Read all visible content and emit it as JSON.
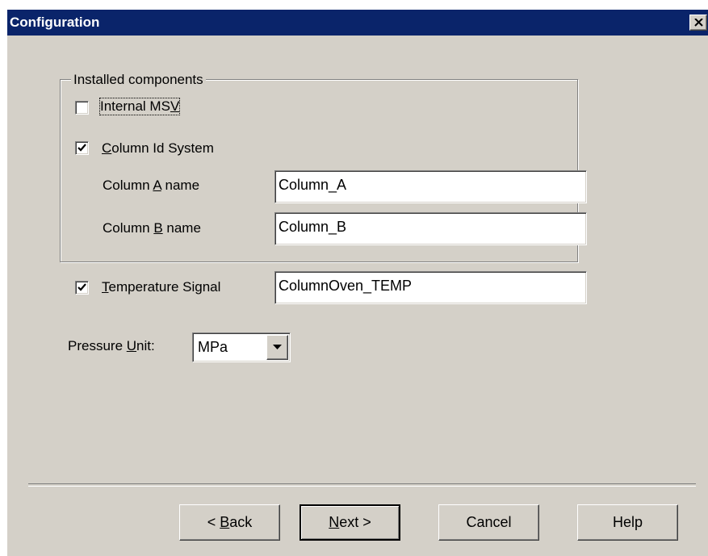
{
  "window": {
    "title": "Configuration"
  },
  "group": {
    "legend": "Installed components",
    "internal_msv": {
      "label": "Internal MSV",
      "checked": false
    },
    "column_id_system": {
      "label": "Column Id System",
      "checked": true
    },
    "column_a": {
      "label": "Column A name",
      "value": "Column_A"
    },
    "column_b": {
      "label": "Column B name",
      "value": "Column_B"
    }
  },
  "temperature": {
    "label": "Temperature Signal",
    "checked": true,
    "value": "ColumnOven_TEMP"
  },
  "pressure": {
    "label": "Pressure Unit:",
    "value": "MPa"
  },
  "buttons": {
    "back": "< Back",
    "next": "Next >",
    "cancel": "Cancel",
    "help": "Help"
  },
  "icons": {
    "close": "close-icon",
    "check": "checkmark-icon",
    "dropdown": "dropdown-arrow-icon"
  }
}
